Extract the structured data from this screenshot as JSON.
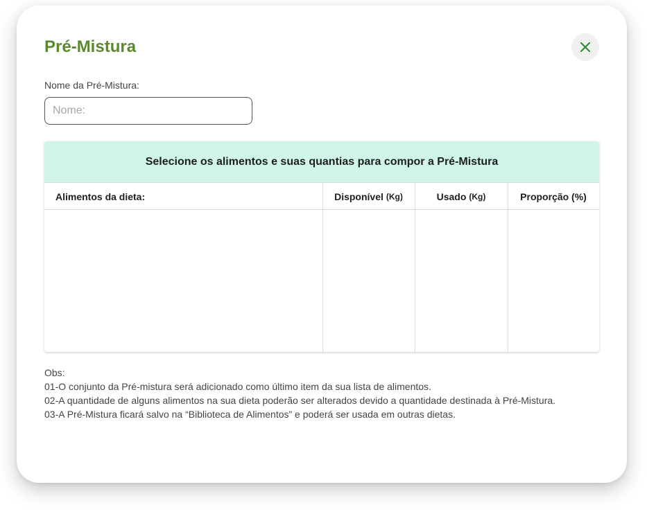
{
  "modal": {
    "title": "Pré-Mistura"
  },
  "name_field": {
    "label": "Nome da Pré-Mistura:",
    "placeholder": "Nome:",
    "value": ""
  },
  "table": {
    "header": "Selecione os alimentos e suas quantias para compor a Pré-Mistura",
    "columns": [
      {
        "label": "Alimentos da dieta:",
        "unit": ""
      },
      {
        "label": "Disponível",
        "unit": "(Kg)"
      },
      {
        "label": "Usado",
        "unit": "(Kg)"
      },
      {
        "label": "Proporção (%)",
        "unit": ""
      }
    ],
    "rows": []
  },
  "notes": {
    "title": "Obs:",
    "lines": [
      "01-O conjunto da Pré-mistura será adicionado como último item da sua lista de alimentos.",
      "02-A quantidade de alguns alimentos na sua dieta poderão ser alterados devido a quantidade destinada à Pré-Mistura.",
      "03-A Pré-Mistura ficará salvo na “Biblioteca de Alimentos” e poderá ser usada em outras dietas."
    ]
  },
  "icons": {
    "close": "close-icon"
  },
  "colors": {
    "title_green": "#5a8a2e",
    "close_icon_green": "#2e8b3a",
    "table_header_bg": "#cef5e5"
  }
}
